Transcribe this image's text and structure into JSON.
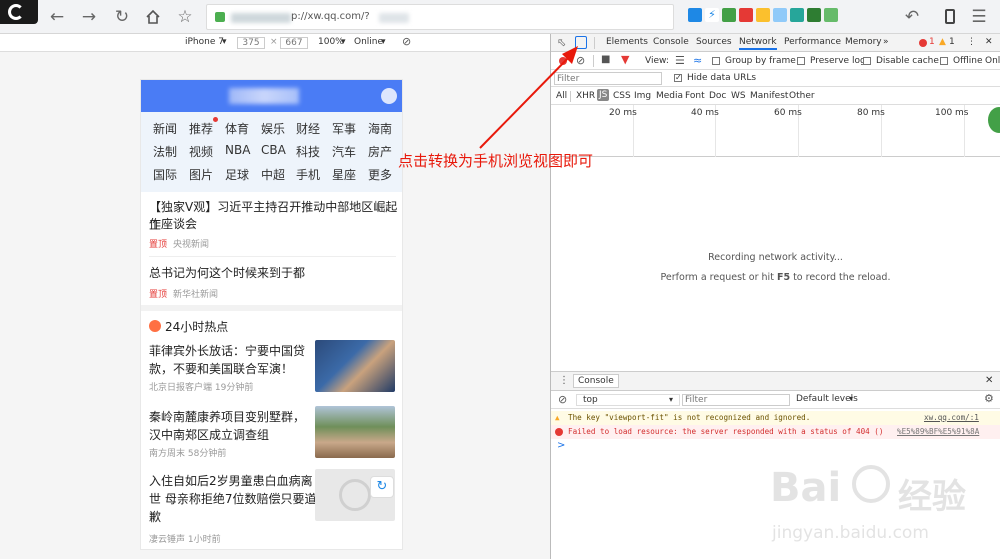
{
  "browser": {
    "url_text": "p://xw.qq.com/?",
    "icons": [
      "back-icon",
      "forward-icon",
      "reload-icon",
      "home-icon",
      "star-icon",
      "undo-icon",
      "tablet-icon",
      "menu-icon"
    ]
  },
  "device_toolbar": {
    "device": "iPhone 7",
    "width": "375",
    "height": "667",
    "zoom": "100%",
    "network": "Online"
  },
  "phone": {
    "categories": [
      [
        "新闻",
        "推荐",
        "体育",
        "娱乐",
        "财经",
        "军事",
        "海南"
      ],
      [
        "法制",
        "视频",
        "NBA",
        "CBA",
        "科技",
        "汽车",
        "房产"
      ],
      [
        "国际",
        "图片",
        "足球",
        "中超",
        "手机",
        "星座",
        "更多"
      ]
    ],
    "top_news": [
      {
        "title_line1": "【独家V观】习近平主持召开推动中部地区崛起工",
        "title_line2": "作座谈会",
        "tag": "置顶",
        "source": "央视新闻"
      },
      {
        "title_line1": "总书记为何这个时候来到于都",
        "tag": "置顶",
        "source": "新华社新闻"
      }
    ],
    "hot_title": "24小时热点",
    "hot_news": [
      {
        "line1": "菲律宾外长放话：宁要中国贷",
        "line2": "款，不要和美国联合军演！",
        "meta": "北京日报客户端   19分钟前"
      },
      {
        "line1": "秦岭南麓康养项目变别墅群，",
        "line2": "汉中南郑区成立调查组",
        "meta": "南方周末   58分钟前"
      },
      {
        "line1": "入住自如后2岁男童患白血病离",
        "line2": "世 母亲称拒绝7位数赔偿只要道",
        "line3": "歉",
        "meta": "凄云锤声   1小时前"
      }
    ]
  },
  "devtools": {
    "tabs": [
      "Elements",
      "Console",
      "Sources",
      "Network",
      "Performance",
      "Memory"
    ],
    "active_tab": "Network",
    "error_count": "1",
    "warn_count": "1",
    "net_toolbar": {
      "view": "View:",
      "group": "Group by frame",
      "preserve": "Preserve log",
      "disable_cache": "Disable cache",
      "offline": "Offline",
      "online": "Onl"
    },
    "filter_placeholder": "Filter",
    "hide_urls": "Hide data URLs",
    "types": [
      "All",
      "XHR",
      "JS",
      "CSS",
      "Img",
      "Media",
      "Font",
      "Doc",
      "WS",
      "Manifest",
      "Other"
    ],
    "ticks": [
      "20 ms",
      "40 ms",
      "60 ms",
      "80 ms",
      "100 ms"
    ],
    "recording": "Recording network activity...",
    "hint_pre": "Perform a request or hit ",
    "hint_key": "F5",
    "hint_post": " to record the reload.",
    "console_tab": "Console",
    "context": "top",
    "con_filter": "Filter",
    "levels": "Default levels",
    "warn_msg": "The key \"viewport-fit\" is not recognized and ignored.",
    "warn_src": "xw.qq.com/:1",
    "err_msg": "Failed to load resource: the server responded with a status of 404 ()",
    "err_src": "%E5%89%BF%E5%91%8A",
    "prompt": ">"
  },
  "annotation": "点击转换为手机浏览视图即可",
  "watermark": {
    "brand": "Bai",
    "brand2": "经验",
    "url": "jingyan.baidu.com"
  },
  "colors": {
    "accent": "#4a7cf5",
    "annotation": "#e8190b",
    "error": "#e53935",
    "warn_bg": "#fffbe5",
    "err_bg": "#fff0f0"
  }
}
